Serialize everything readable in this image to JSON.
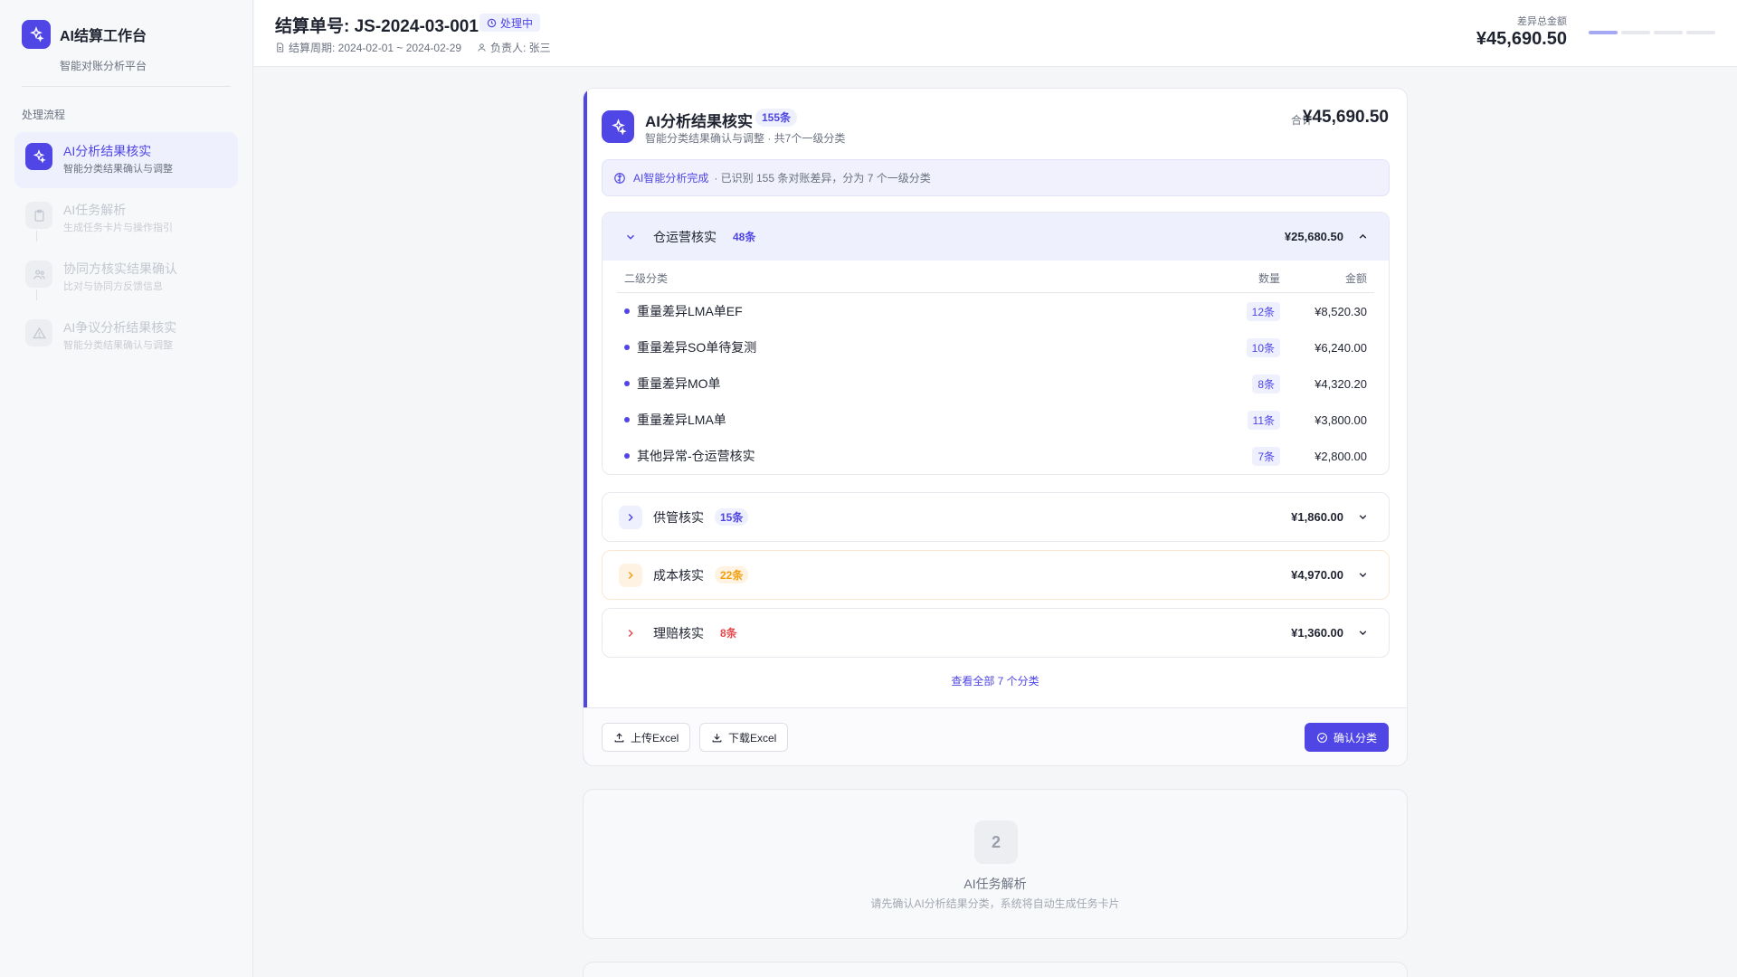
{
  "sidebar": {
    "brand_title": "AI结算工作台",
    "brand_sub": "智能对账分析平台",
    "section_label": "处理流程",
    "steps": [
      {
        "title": "AI分析结果核实",
        "desc": "智能分类结果确认与调整"
      },
      {
        "title": "AI任务解析",
        "desc": "生成任务卡片与操作指引"
      },
      {
        "title": "协同方核实结果确认",
        "desc": "比对与协同方反馈信息"
      },
      {
        "title": "AI争议分析结果核实",
        "desc": "智能分类结果确认与调整"
      }
    ]
  },
  "header": {
    "order_title": "结算单号: JS-2024-03-001",
    "status": "处理中",
    "period": "结算周期: 2024-02-01 ~ 2024-02-29",
    "owner": "负责人: 张三",
    "total_label": "差异总金额",
    "total_value": "¥45,690.50",
    "progress_steps": 4,
    "progress_current": 1
  },
  "card": {
    "title": "AI分析结果核实",
    "count": "155条",
    "subtitle": "智能分类结果确认与调整 · 共7个一级分类",
    "sum_label": "合计",
    "sum_value": "¥45,690.50",
    "banner_highlight": "AI智能分析完成",
    "banner_text": "· 已识别 155 条对账差异，分为 7 个一级分类",
    "table_headers": {
      "name": "二级分类",
      "qty": "数量",
      "amount": "金额"
    },
    "groups": [
      {
        "name": "仓运营核实",
        "count": "48条",
        "amount": "¥25,680.50",
        "color": "#4f46e5",
        "open": true,
        "items": [
          {
            "name": "重量差异LMA单EF",
            "qty": "12条",
            "amount": "¥8,520.30"
          },
          {
            "name": "重量差异SO单待复测",
            "qty": "10条",
            "amount": "¥6,240.00"
          },
          {
            "name": "重量差异MO单",
            "qty": "8条",
            "amount": "¥4,320.20"
          },
          {
            "name": "重量差异LMA单",
            "qty": "11条",
            "amount": "¥3,800.00"
          },
          {
            "name": "其他异常-仓运营核实",
            "qty": "7条",
            "amount": "¥2,800.00"
          }
        ]
      },
      {
        "name": "供管核实",
        "count": "15条",
        "amount": "¥1,860.00",
        "color": "#4f46e5",
        "open": false
      },
      {
        "name": "成本核实",
        "count": "22条",
        "amount": "¥4,970.00",
        "color": "#f59e0b",
        "open": false
      },
      {
        "name": "理赔核实",
        "count": "8条",
        "amount": "¥1,360.00",
        "color": "#e5484d",
        "open": false
      }
    ],
    "view_all": "查看全部 7 个分类",
    "upload_label": "上传Excel",
    "download_label": "下载Excel",
    "confirm_label": "确认分类"
  },
  "next_step": {
    "number": "2",
    "title": "AI任务解析",
    "desc": "请先确认AI分析结果分类，系统将自动生成任务卡片"
  },
  "colors": {
    "accent": "#4f46e5",
    "warning": "#f59e0b",
    "danger": "#e5484d"
  }
}
